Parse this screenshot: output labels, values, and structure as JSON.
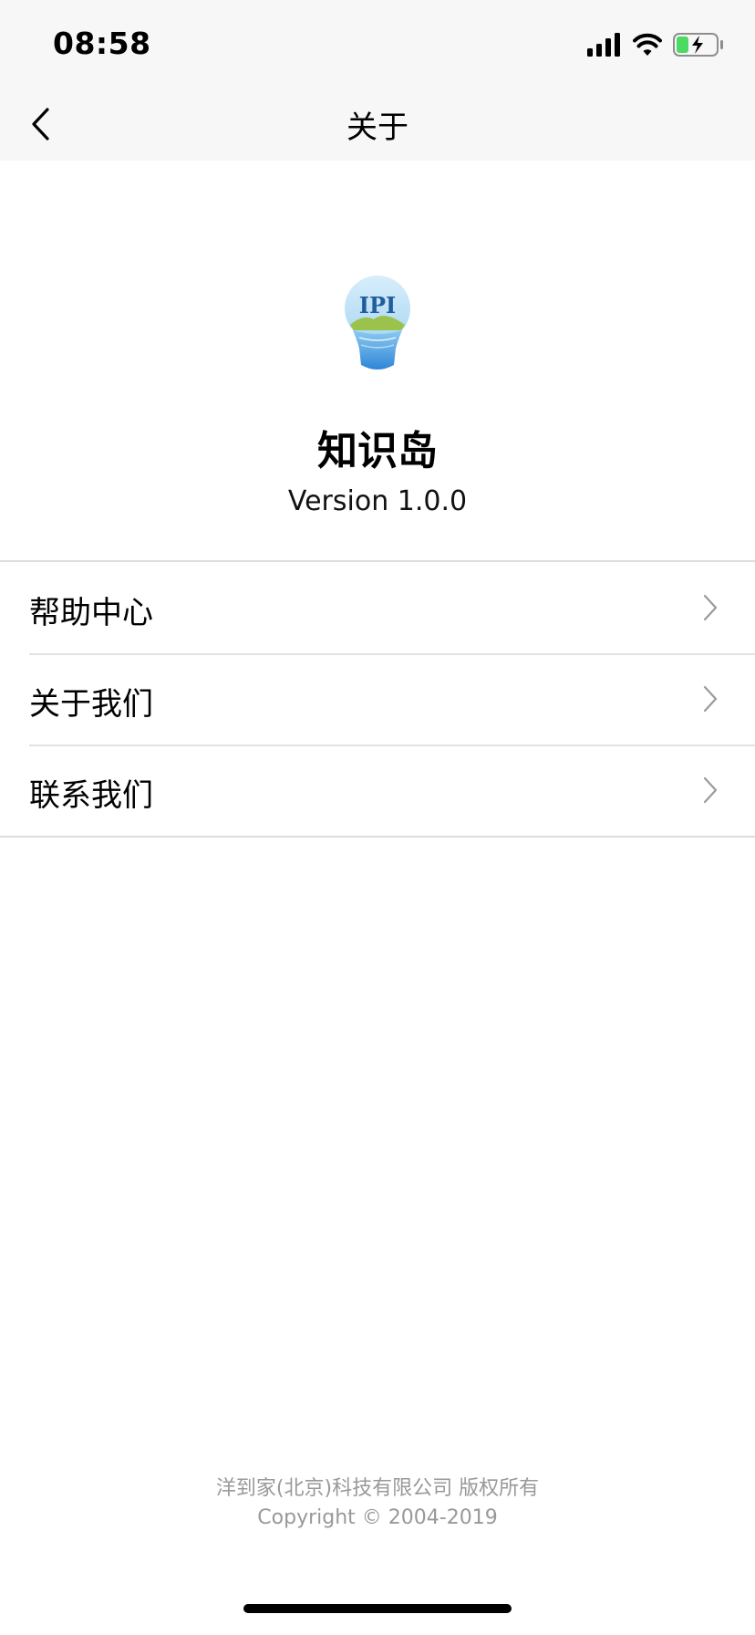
{
  "status_bar": {
    "time": "08:58",
    "icons": [
      "signal-icon",
      "wifi-icon",
      "battery-charging-icon"
    ]
  },
  "nav": {
    "back_icon": "chevron-left-icon",
    "title": "关于"
  },
  "app": {
    "logo_text": "IPI",
    "name": "知识岛",
    "version": "Version 1.0.0"
  },
  "menu": {
    "items": [
      {
        "label": "帮助中心",
        "icon": "chevron-right-icon"
      },
      {
        "label": "关于我们",
        "icon": "chevron-right-icon"
      },
      {
        "label": "联系我们",
        "icon": "chevron-right-icon"
      }
    ]
  },
  "footer": {
    "company": "洋到家(北京)科技有限公司 版权所有",
    "copyright": "Copyright © 2004-2019"
  },
  "colors": {
    "header_bg": "#f7f7f7",
    "divider": "#dddddd",
    "footer_text": "#999999",
    "battery_green": "#4cd964",
    "logo_blue": "#3a8fd8",
    "logo_green": "#9bc24a"
  }
}
